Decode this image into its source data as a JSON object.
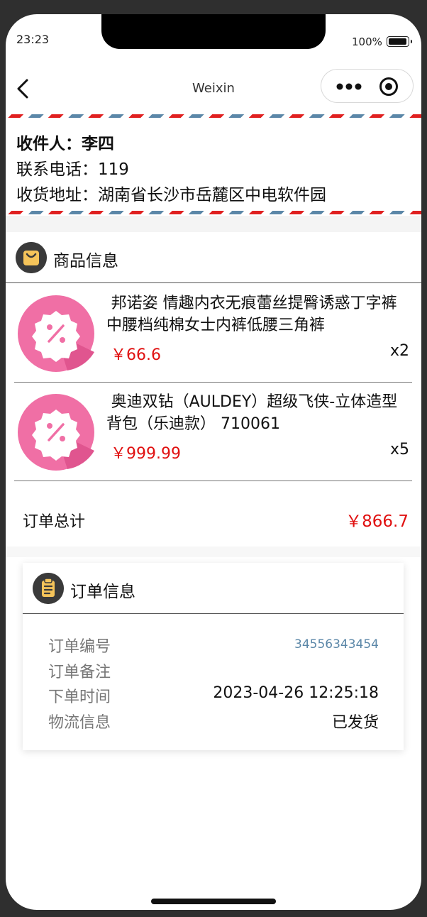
{
  "status_bar": {
    "time": "23:23",
    "battery": "100%"
  },
  "navbar": {
    "title": "Weixin"
  },
  "address": {
    "recipient": "收件人：李四",
    "phone": "联系电话：119",
    "address": "收货地址：湖南省长沙市岳麓区中电软件园"
  },
  "goods": {
    "title": "商品信息",
    "items": [
      {
        "name": "邦诺姿 情趣内衣无痕蕾丝提臀诱惑丁字裤中腰档纯棉女士内裤低腰三角裤",
        "price": "￥66.6",
        "qty": "x2"
      },
      {
        "name": "奥迪双钻（AULDEY）超级飞侠-立体造型背包（乐迪款） 710061",
        "price": "￥999.99",
        "qty": "x5"
      }
    ],
    "total_label": "订单总计",
    "total_value": "￥866.7"
  },
  "order": {
    "title": "订单信息",
    "rows": [
      {
        "label": "订单编号",
        "value": "34556343454"
      },
      {
        "label": "订单备注",
        "value": ""
      },
      {
        "label": "下单时间",
        "value": "2023-04-26 12:25:18"
      },
      {
        "label": "物流信息",
        "value": "已发货"
      }
    ]
  },
  "colors": {
    "price": "#e01010",
    "accent_blue": "#5b87a8",
    "stripe_red": "#e02020",
    "icon_yellow": "#f5c45a",
    "coupon_pink": "#f06fa5"
  }
}
